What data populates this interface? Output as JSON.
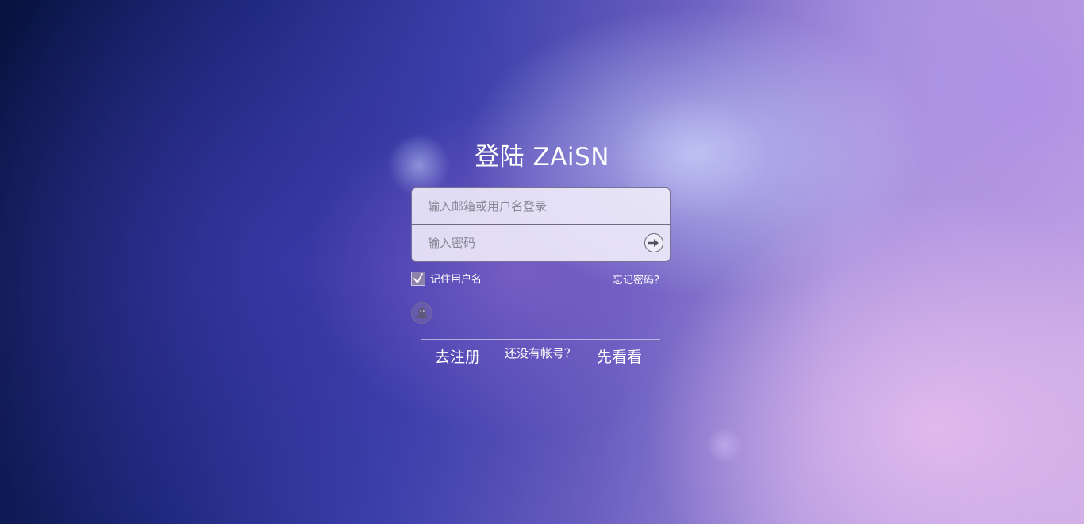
{
  "page": {
    "title": "登陆 ZAiSN"
  },
  "login_form": {
    "username_placeholder": "输入邮箱或用户名登录",
    "username_value": "",
    "password_placeholder": "输入密码",
    "password_value": "",
    "submit_icon": "arrow-right-icon"
  },
  "options": {
    "remember_label": "记住用户名",
    "remember_checked": true,
    "forgot_label": "忘记密码？"
  },
  "social": {
    "qq_icon": "qq-penguin-icon"
  },
  "footer": {
    "register_label": "去注册",
    "no_account_label": "还没有帐号？",
    "preview_label": "先看看"
  },
  "colors": {
    "text": "#ffffff",
    "input_bg": "#f0ecfa",
    "input_border": "#6e648c",
    "background_dark": "#07123e",
    "background_light": "#c9a8e3"
  }
}
